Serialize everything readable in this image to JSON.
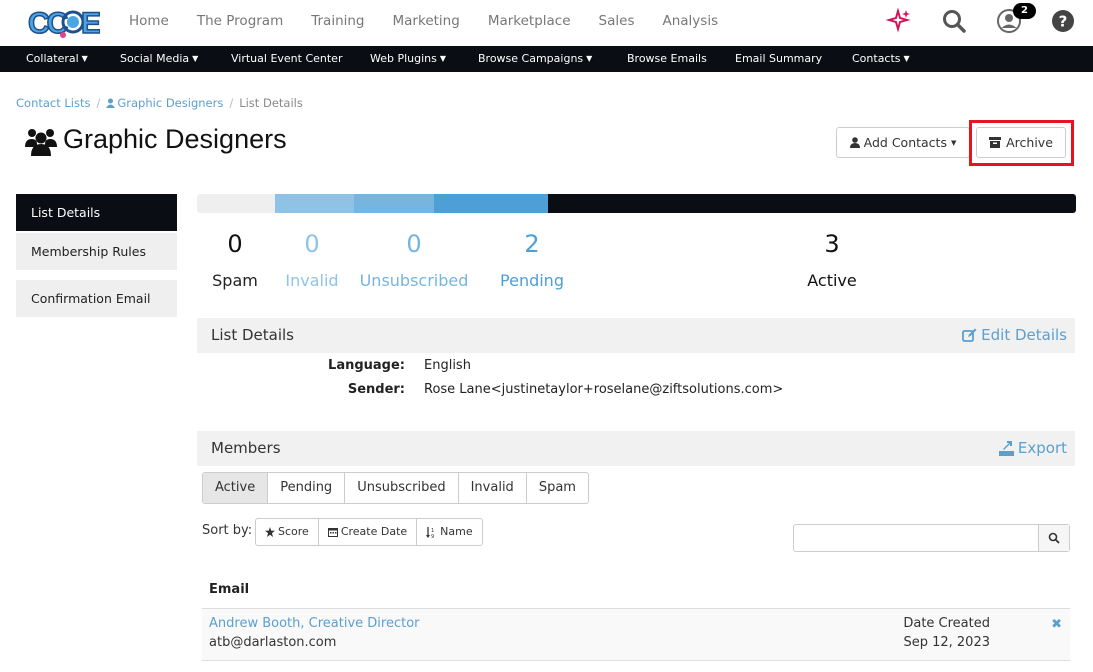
{
  "brand": {
    "logo_text": "CCOE"
  },
  "topnav": [
    "Home",
    "The Program",
    "Training",
    "Marketing",
    "Marketplace",
    "Sales",
    "Analysis"
  ],
  "notifications": {
    "count": "2"
  },
  "subnav": [
    {
      "label": "Collateral",
      "dropdown": true
    },
    {
      "label": "Social Media",
      "dropdown": true
    },
    {
      "label": "Virtual Event Center",
      "dropdown": false
    },
    {
      "label": "Web Plugins",
      "dropdown": true
    },
    {
      "label": "Browse Campaigns",
      "dropdown": true
    },
    {
      "label": "Browse Emails",
      "dropdown": false
    },
    {
      "label": "Email Summary",
      "dropdown": false
    },
    {
      "label": "Contacts",
      "dropdown": true
    }
  ],
  "breadcrumb": {
    "item1": "Contact Lists",
    "item2": "Graphic Designers",
    "current": "List Details"
  },
  "page": {
    "title": "Graphic Designers"
  },
  "actions": {
    "add_contacts": "Add Contacts",
    "archive": "Archive"
  },
  "sidebar": {
    "items": [
      "List Details",
      "Membership Rules",
      "Confirmation Email"
    ]
  },
  "stats": [
    {
      "label": "Spam",
      "value": "0"
    },
    {
      "label": "Invalid",
      "value": "0"
    },
    {
      "label": "Unsubscribed",
      "value": "0"
    },
    {
      "label": "Pending",
      "value": "2"
    },
    {
      "label": "Active",
      "value": "3"
    }
  ],
  "colors": {
    "accent": "#5b9fd0",
    "dark": "#0a0d13",
    "highlight": "#e8131f"
  },
  "list_details": {
    "header": "List Details",
    "edit": "Edit Details",
    "language_label": "Language:",
    "language": "English",
    "sender_label": "Sender:",
    "sender": "Rose Lane<justinetaylor+roselane@ziftsolutions.com>"
  },
  "members": {
    "header": "Members",
    "export": "Export",
    "tabs": [
      "Active",
      "Pending",
      "Unsubscribed",
      "Invalid",
      "Spam"
    ],
    "sort_label": "Sort by:",
    "sorts": [
      "Score",
      "Create Date",
      "Name"
    ],
    "search_placeholder": "",
    "col_email": "Email",
    "rows": [
      {
        "name": "Andrew Booth, Creative Director",
        "email": "atb@darlaston.com",
        "date_label": "Date Created",
        "date": "Sep 12, 2023"
      }
    ]
  }
}
